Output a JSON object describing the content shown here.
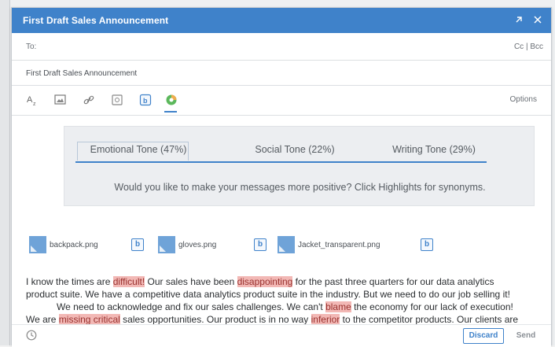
{
  "window": {
    "title": "First Draft Sales Announcement",
    "expand_icon": "expand-icon",
    "close_icon": "close-icon"
  },
  "fields": {
    "to_label": "To:",
    "cc_bcc": "Cc | Bcc",
    "subject": "First Draft Sales Announcement"
  },
  "toolbar": {
    "icons": [
      "text-format-icon",
      "image-icon",
      "link-icon",
      "template-icon",
      "box-icon",
      "tone-analyzer-icon"
    ],
    "options_label": "Options"
  },
  "tone": {
    "tabs": [
      {
        "label": "Emotional Tone (47%)",
        "active": true
      },
      {
        "label": "Social Tone (22%)",
        "active": false
      },
      {
        "label": "Writing Tone (29%)",
        "active": false
      }
    ],
    "message": "Would you like to make your messages more positive? Click Highlights for synonyms."
  },
  "attachments": [
    {
      "name": "backpack.png",
      "icon": "box-icon"
    },
    {
      "name": "gloves.png",
      "icon": "box-icon"
    },
    {
      "name": "Jacket_transparent.png",
      "icon": "box-icon"
    }
  ],
  "body": {
    "l1a": "I know the times are ",
    "l1h1": "difficult!",
    "l1b": " Our sales have been ",
    "l1h2": "disappointing",
    "l1c": " for the past three quarters for our data analytics",
    "l2": "product suite. We have a competitive data analytics product suite in the industry. But we need to do our job selling it!",
    "l3a": "We need to acknowledge and fix our sales challenges. We can't ",
    "l3h": "blame",
    "l3b": " the economy for our lack of execution!",
    "l4a": "We are ",
    "l4h1": "missing critical",
    "l4b": " sales opportunities. Our product  is in no way ",
    "l4h2": "inferior",
    "l4c": " to the competitor products. Our clients are"
  },
  "footer": {
    "discard_label": "Discard",
    "send_label": "Send"
  },
  "colors": {
    "accent": "#3f82ca",
    "highlight": "#f2b8b5"
  }
}
